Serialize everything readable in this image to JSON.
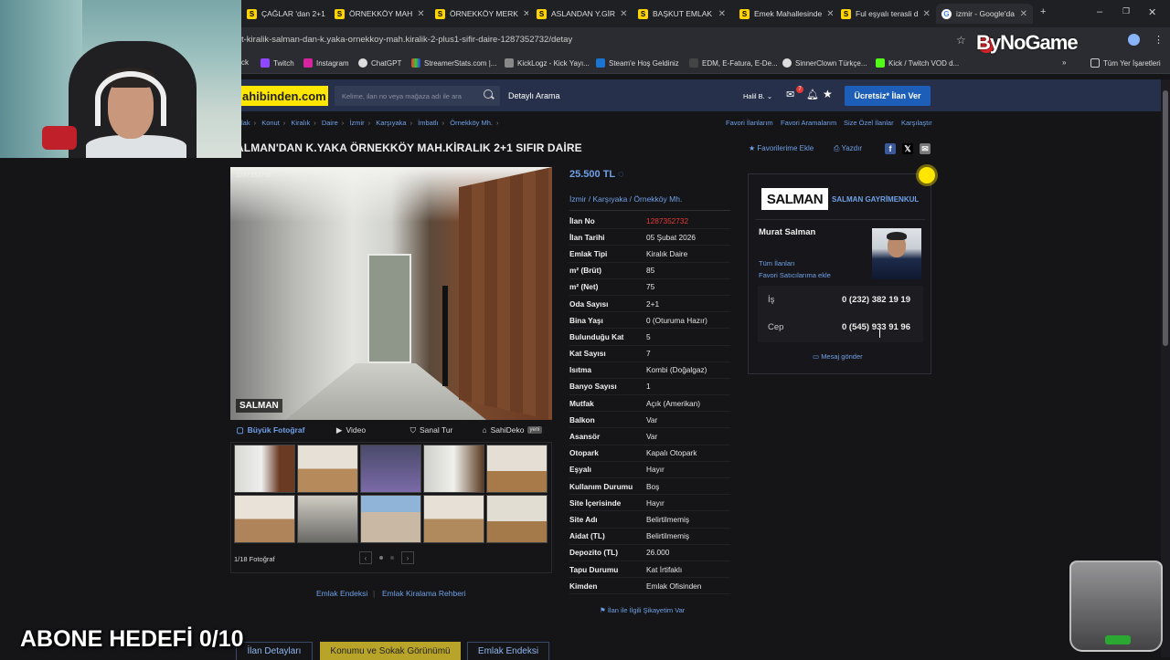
{
  "browser": {
    "tabs": [
      {
        "label": "ÇAĞLAR 'dan 2+1",
        "favicon": "sahibinden-icon"
      },
      {
        "label": "ÖRNEKKÖY MAH",
        "favicon": "sahibinden-icon"
      },
      {
        "label": "ÖRNEKKÖY MERK",
        "favicon": "sahibinden-icon"
      },
      {
        "label": "ASLANDAN Y.GİR",
        "favicon": "sahibinden-icon"
      },
      {
        "label": "BAŞKUT EMLAK",
        "favicon": "sahibinden-icon"
      },
      {
        "label": "Emek Mahallesinde",
        "favicon": "sahibinden-icon"
      },
      {
        "label": "Ful eşyalı terasli d",
        "favicon": "sahibinden-icon"
      },
      {
        "label": "izmir - Google'da",
        "favicon": "google-icon"
      }
    ],
    "new_tab": "+",
    "url": "t-kiralik-salman-dan-k.yaka-ornekkoy-mah.kiralik-2-plus1-sifir-daire-1287352732/detay",
    "bookmarks": [
      "ck",
      "Twitch",
      "Instagram",
      "ChatGPT",
      "StreamerStats.com |...",
      "KickLogz - Kick Yayı...",
      "Steam'e Hoş Geldiniz",
      "EDM, E-Fatura, E-De...",
      "SinnerClown Türkçe...",
      "Kick / Twitch VOD d...",
      "»",
      "Tüm Yer İşaretleri"
    ]
  },
  "site": {
    "logo": "ahibinden.com",
    "search_placeholder": "Kelime, ilan no veya mağaza adı ile ara",
    "detailed_search": "Detaylı Arama",
    "user": "Halil B.",
    "notif_count": "7",
    "cta": "Ücretsiz* İlan Ver"
  },
  "breadcrumb": [
    "lak",
    "Konut",
    "Kiralık",
    "Daire",
    "İzmir",
    "Karşıyaka",
    "İmbatlı",
    "Örnekköy Mh."
  ],
  "top_links": [
    "Favori İlanlarım",
    "Favori Aramalarım",
    "Size Özel İlanlar",
    "Karşılaştır"
  ],
  "listing": {
    "title": "ALMAN'DAN K.YAKA ÖRNEKKÖY MAH.KİRALIK 2+1 SIFIR DAİRE",
    "add_favorite": "Favorilerime Ekle",
    "print": "Yazdır",
    "price": "25.500 TL",
    "location": [
      "İzmir",
      "Karşıyaka",
      "Örnekköy Mh."
    ],
    "photo_watermark": "SALMAN",
    "photo_id": "1287352732",
    "photo_tabs": [
      {
        "label": "Büyük Fotoğraf",
        "icon": "photo-icon"
      },
      {
        "label": "Video",
        "icon": "play-icon"
      },
      {
        "label": "Sanal Tur",
        "icon": "tour-icon"
      },
      {
        "label": "SahiDeko",
        "icon": "home-icon",
        "badge": "yeni"
      }
    ],
    "photo_count": "1/18 Fotoğraf",
    "under_links": [
      "Emlak Endeksi",
      "Emlak Kiralama Rehberi"
    ],
    "details": [
      {
        "k": "İlan No",
        "v": "1287352732"
      },
      {
        "k": "İlan Tarihi",
        "v": "05 Şubat 2026"
      },
      {
        "k": "Emlak Tipi",
        "v": "Kiralık Daire"
      },
      {
        "k": "m² (Brüt)",
        "v": "85"
      },
      {
        "k": "m² (Net)",
        "v": "75"
      },
      {
        "k": "Oda Sayısı",
        "v": "2+1"
      },
      {
        "k": "Bina Yaşı",
        "v": "0 (Oturuma Hazır)"
      },
      {
        "k": "Bulunduğu Kat",
        "v": "5"
      },
      {
        "k": "Kat Sayısı",
        "v": "7"
      },
      {
        "k": "Isıtma",
        "v": "Kombi (Doğalgaz)"
      },
      {
        "k": "Banyo Sayısı",
        "v": "1"
      },
      {
        "k": "Mutfak",
        "v": "Açık (Amerikan)"
      },
      {
        "k": "Balkon",
        "v": "Var"
      },
      {
        "k": "Asansör",
        "v": "Var"
      },
      {
        "k": "Otopark",
        "v": "Kapalı Otopark"
      },
      {
        "k": "Eşyalı",
        "v": "Hayır"
      },
      {
        "k": "Kullanım Durumu",
        "v": "Boş"
      },
      {
        "k": "Site İçerisinde",
        "v": "Hayır"
      },
      {
        "k": "Site Adı",
        "v": "Belirtilmemiş"
      },
      {
        "k": "Aidat (TL)",
        "v": "Belirtilmemiş"
      },
      {
        "k": "Depozito (TL)",
        "v": "26.000"
      },
      {
        "k": "Tapu Durumu",
        "v": "Kat İrtifaklı"
      },
      {
        "k": "Kimden",
        "v": "Emlak Ofisinden"
      }
    ],
    "complaint": "İlan ile İlgili Şikayetim Var"
  },
  "seller": {
    "brand": "SALMAN",
    "firm": "SALMAN GAYRİMENKUL",
    "name": "Murat Salman",
    "all_listings": "Tüm İlanları",
    "add_fav_seller": "Favori Satıcılarıma ekle",
    "phones": [
      {
        "label": "İş",
        "number": "0 (232) 382 19 19"
      },
      {
        "label": "Cep",
        "number": "0 (545) 933 91 96"
      }
    ],
    "message": "Mesaj gönder"
  },
  "bottom_tabs": [
    "İlan Detayları",
    "Konumu ve Sokak Görünümü",
    "Emlak Endeksi"
  ],
  "overlay": {
    "brand": "ByNoGame",
    "goal": "ABONE HEDEFİ 0/10"
  },
  "colors": {
    "accent": "#6fa0e6",
    "logo": "#ffe600",
    "cta": "#1d5fb8",
    "red": "#e53935"
  }
}
